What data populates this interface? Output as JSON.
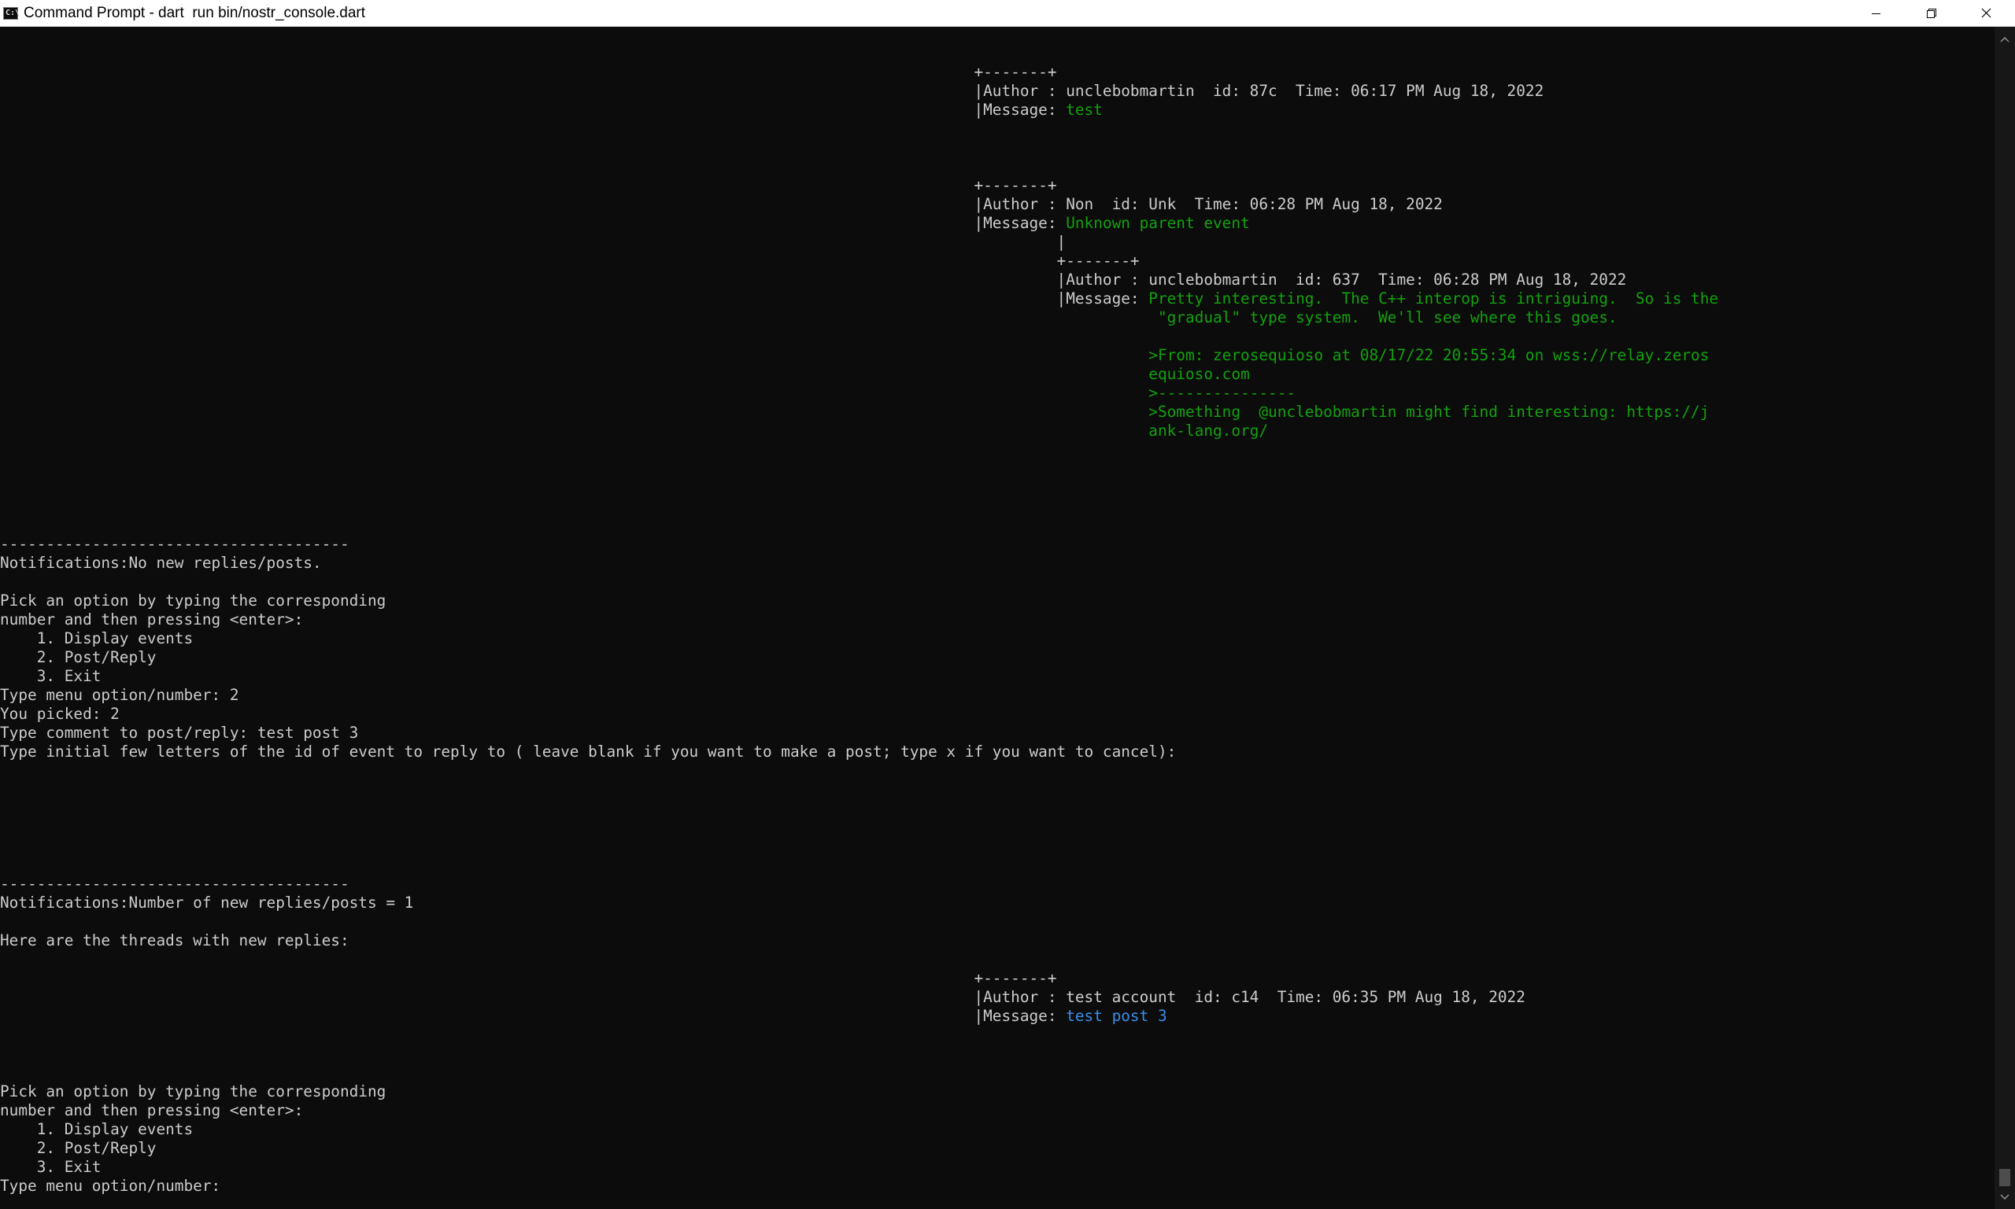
{
  "window": {
    "title": "Command Prompt - dart  run bin/nostr_console.dart"
  },
  "console": {
    "lines": [
      [
        {
          "t": "                                                                                                          +-------+"
        }
      ],
      [
        {
          "t": "                                                                                                          |Author : unclebobmartin  id: 87c  Time: 06:17 PM Aug 18, 2022"
        }
      ],
      [
        {
          "t": "                                                                                                          |Message: "
        },
        {
          "t": "test",
          "c": "g"
        }
      ],
      [],
      [],
      [],
      [
        {
          "t": "                                                                                                          +-------+"
        }
      ],
      [
        {
          "t": "                                                                                                          |Author : Non  id: Unk  Time: 06:28 PM Aug 18, 2022"
        }
      ],
      [
        {
          "t": "                                                                                                          |Message: "
        },
        {
          "t": "Unknown parent event",
          "c": "g"
        }
      ],
      [
        {
          "t": "                                                                                                                   |"
        }
      ],
      [
        {
          "t": "                                                                                                                   +-------+"
        }
      ],
      [
        {
          "t": "                                                                                                                   |Author : unclebobmartin  id: 637  Time: 06:28 PM Aug 18, 2022"
        }
      ],
      [
        {
          "t": "                                                                                                                   |Message: "
        },
        {
          "t": "Pretty interesting.  The C++ interop is intriguing.  So is the",
          "c": "g"
        }
      ],
      [
        {
          "t": "                                                                                                                             "
        },
        {
          "t": " \"gradual\" type system.  We'll see where this goes.",
          "c": "g"
        }
      ],
      [],
      [
        {
          "t": "                                                                                                                             "
        },
        {
          "t": ">From: zerosequioso at 08/17/22 20:55:34 on wss://relay.zeros",
          "c": "g"
        }
      ],
      [
        {
          "t": "                                                                                                                             "
        },
        {
          "t": "equioso.com",
          "c": "g"
        }
      ],
      [
        {
          "t": "                                                                                                                             "
        },
        {
          "t": ">---------------",
          "c": "g"
        }
      ],
      [
        {
          "t": "                                                                                                                             "
        },
        {
          "t": ">Something  @unclebobmartin might find interesting: https://j",
          "c": "g"
        }
      ],
      [
        {
          "t": "                                                                                                                             "
        },
        {
          "t": "ank-lang.org/",
          "c": "g"
        }
      ],
      [],
      [],
      [],
      [],
      [],
      [
        {
          "t": "--------------------------------------"
        }
      ],
      [
        {
          "t": "Notifications:No new replies/posts."
        }
      ],
      [],
      [
        {
          "t": "Pick an option by typing the corresponding"
        }
      ],
      [
        {
          "t": "number and then pressing <enter>:"
        }
      ],
      [
        {
          "t": "    1. Display events"
        }
      ],
      [
        {
          "t": "    2. Post/Reply"
        }
      ],
      [
        {
          "t": "    3. Exit"
        }
      ],
      [
        {
          "t": "Type menu option/number: 2"
        }
      ],
      [
        {
          "t": "You picked: 2"
        }
      ],
      [
        {
          "t": "Type comment to post/reply: test post 3"
        }
      ],
      [
        {
          "t": "Type initial few letters of the id of event to reply to ( leave blank if you want to make a post; type x if you want to cancel):"
        }
      ],
      [],
      [],
      [],
      [],
      [],
      [],
      [
        {
          "t": "--------------------------------------"
        }
      ],
      [
        {
          "t": "Notifications:Number of new replies/posts = 1"
        }
      ],
      [],
      [
        {
          "t": "Here are the threads with new replies:"
        }
      ],
      [],
      [
        {
          "t": "                                                                                                          +-------+"
        }
      ],
      [
        {
          "t": "                                                                                                          |Author : test account  id: c14  Time: 06:35 PM Aug 18, 2022"
        }
      ],
      [
        {
          "t": "                                                                                                          |Message: "
        },
        {
          "t": "test post 3",
          "c": "b"
        }
      ],
      [],
      [],
      [],
      [
        {
          "t": "Pick an option by typing the corresponding"
        }
      ],
      [
        {
          "t": "number and then pressing <enter>:"
        }
      ],
      [
        {
          "t": "    1. Display events"
        }
      ],
      [
        {
          "t": "    2. Post/Reply"
        }
      ],
      [
        {
          "t": "    3. Exit"
        }
      ],
      [
        {
          "t": "Type menu option/number: "
        }
      ]
    ]
  }
}
